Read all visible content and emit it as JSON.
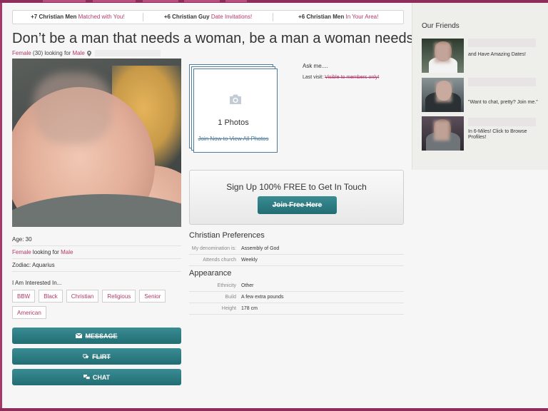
{
  "banner": [
    {
      "bold": "+7 Christian Men",
      "rest": " Matched with You!"
    },
    {
      "bold": "+6 Christian Guy",
      "rest": " Date Invitations!"
    },
    {
      "bold": "+6 Christian Men",
      "rest": " In Your Area!"
    }
  ],
  "profile": {
    "title": "Don’t be a man that needs a woman, be a man a woman needs:)",
    "sub_gender": "Female",
    "sub_age": "(30) looking for",
    "sub_seeking": "Male",
    "age_label": "Age: 30",
    "gender": "Female",
    "looking_for": "looking for",
    "seeking": "Male",
    "zodiac": "Zodiac: Aquarius",
    "interested_label": "I Am Interested In...",
    "interests": [
      "BBW",
      "Black",
      "Christian",
      "Religious",
      "Senior",
      "American"
    ],
    "actions": {
      "message": "MESSAGE",
      "flirt": "FLIRT",
      "chat": "CHAT"
    }
  },
  "photos": {
    "count_label": "1 Photos",
    "join_label": "Join Now to View All Photos"
  },
  "ask_me": "Ask me....",
  "last_visit": {
    "label": "Last visit:",
    "value": "Visible to members only!"
  },
  "signup": {
    "text": "Sign Up 100% FREE to Get In Touch",
    "button": "Join Free Here"
  },
  "christian_preferences": {
    "title": "Christian Preferences",
    "rows": [
      {
        "k": "My denomination is:",
        "v": "Assembly of God"
      },
      {
        "k": "Attends church",
        "v": "Weekly"
      }
    ]
  },
  "appearance": {
    "title": "Appearance",
    "rows": [
      {
        "k": "Ethnicity",
        "v": "Other"
      },
      {
        "k": "Build",
        "v": "A few extra pounds"
      },
      {
        "k": "Height",
        "v": "178 cm"
      }
    ]
  },
  "friends": {
    "title": "Our Friends",
    "items": [
      {
        "msg": "and Have Amazing Dates!"
      },
      {
        "msg": "\"Want to chat, pretty? Join me.\""
      },
      {
        "msg": "In 6-Miles! Click to Browse Profiles!"
      }
    ]
  },
  "colors": {
    "accent": "#b03a6a",
    "button": "#2c7a81",
    "frame": "#a33a6a"
  }
}
